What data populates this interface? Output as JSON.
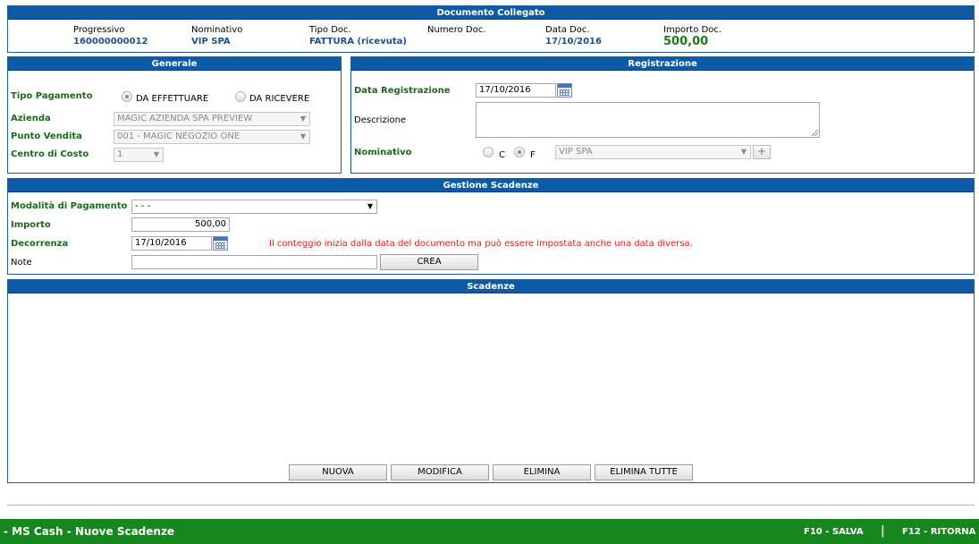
{
  "documento_collegato": {
    "title": "Documento Collegato",
    "fields": [
      {
        "label": "Progressivo",
        "value": "160000000012"
      },
      {
        "label": "Nominativo",
        "value": "VIP SPA"
      },
      {
        "label": "Tipo Doc.",
        "value": "FATTURA (ricevuta)"
      },
      {
        "label": "Numero Doc.",
        "value": ""
      },
      {
        "label": "Data Doc.",
        "value": "17/10/2016"
      },
      {
        "label": "Importo Doc.",
        "value": "500,00"
      }
    ]
  },
  "generale": {
    "title": "Generale",
    "tipo_pagamento_label": "Tipo Pagamento",
    "opt_effettuare": "DA EFFETTUARE",
    "opt_ricevere": "DA RICEVERE",
    "azienda_label": "Azienda",
    "azienda_value": "MAGIC AZIENDA SPA PREVIEW",
    "punto_vendita_label": "Punto Vendita",
    "punto_vendita_value": "001 - MAGIC NEGOZIO ONE",
    "centro_costo_label": "Centro di Costo",
    "centro_costo_value": "1"
  },
  "registrazione": {
    "title": "Registrazione",
    "data_label": "Data Registrazione",
    "data_value": "17/10/2016",
    "descrizione_label": "Descrizione",
    "nominativo_label": "Nominativo",
    "opt_c": "C",
    "opt_f": "F",
    "nominativo_value": "VIP SPA",
    "plus": "+"
  },
  "gestione_scadenze": {
    "title": "Gestione Scadenze",
    "modalita_label": "Modalità di Pagamento",
    "modalita_value": "- - -",
    "importo_label": "Importo",
    "importo_value": "500,00",
    "decorrenza_label": "Decorrenza",
    "decorrenza_value": "17/10/2016",
    "decorrenza_note": "Il conteggio inizia dalla data del documento ma può essere impostata anche una data diversa.",
    "note_label": "Note",
    "note_value": "",
    "crea_button": "CREA"
  },
  "scadenze": {
    "title": "Scadenze",
    "buttons": {
      "nuova": "NUOVA",
      "modifica": "MODIFICA",
      "elimina": "ELIMINA",
      "elimina_tutte": "ELIMINA TUTTE"
    }
  },
  "footer": {
    "app_title": "- MS Cash - Nuove Scadenze",
    "salva": "F10 - SALVA",
    "separator": "|",
    "ritorna": "F12 - RITORNA"
  },
  "colors": {
    "header_blue": "#0d5aa7",
    "label_green": "#1c6b1c",
    "value_blue": "#1f4f8f",
    "footer_green": "#16861f",
    "note_red": "#e0201b"
  }
}
